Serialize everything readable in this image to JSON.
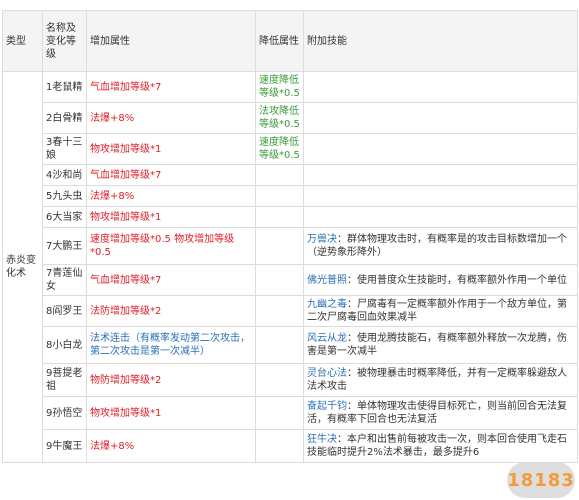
{
  "headers": {
    "type": "类型",
    "name": "名称及变化等级",
    "add": "增加属性",
    "reduce": "降低属性",
    "skill": "附加技能"
  },
  "category": "赤炎变化术",
  "rows": [
    {
      "name": "1老鼠精",
      "add": "气血增加等级*7",
      "reduce": "速度降低等级*0.5",
      "skill_name": "",
      "skill_desc": ""
    },
    {
      "name": "2白骨精",
      "add": "法爆+8%",
      "reduce": "法攻降低等级*0.5",
      "skill_name": "",
      "skill_desc": ""
    },
    {
      "name": "3春十三娘",
      "add": "物攻增加等级*1",
      "reduce": "速度降低等级*0.5",
      "skill_name": "",
      "skill_desc": ""
    },
    {
      "name": "4沙和尚",
      "add": "气血增加等级*7",
      "reduce": "",
      "skill_name": "",
      "skill_desc": ""
    },
    {
      "name": "5九头虫",
      "add": "法爆+8%",
      "reduce": "",
      "skill_name": "",
      "skill_desc": ""
    },
    {
      "name": "6大当家",
      "add": "物攻增加等级*1",
      "reduce": "",
      "skill_name": "",
      "skill_desc": ""
    },
    {
      "name": "7大鹏王",
      "add": "速度增加等级*0.5 物攻增加等级*0.5",
      "reduce": "",
      "skill_name": "万兽决",
      "skill_desc": "：群体物理攻击时，有概率是的攻击目标数增加一个（逆势象形降外）"
    },
    {
      "name": "7青莲仙女",
      "add": "气血增加等级*7",
      "reduce": "",
      "skill_name": "佛光普照",
      "skill_desc": "：使用普度众生技能时，有概率额外作用一个单位"
    },
    {
      "name": "8阎罗王",
      "add": "法防增加等级*2",
      "reduce": "",
      "skill_name": "九幽之毒",
      "skill_desc": "：尸腐毒有一定概率额外作用于一个敌方单位，第二次尸腐毒回血效果减半"
    },
    {
      "name": "8小白龙",
      "add": "法术连击（有概率发动第二次攻击，第二次攻击是第一次减半）",
      "reduce": "",
      "skill_name": "风云从龙",
      "skill_desc": "：使用龙腾技能石，有概率额外释放一次龙腾，伤害是第一次减半"
    },
    {
      "name": "9菩提老祖",
      "add": "物防增加等级*2",
      "reduce": "",
      "skill_name": "灵台心法",
      "skill_desc": "：被物理暴击时概率降低，并有一定概率躲避敌人法术攻击"
    },
    {
      "name": "9孙悟空",
      "add": "物攻增加等级*1",
      "reduce": "",
      "skill_name": "奋起千钧",
      "skill_desc": "：单体物理攻击使得目标死亡，则当前回合无法复活，有概率下回合也无法复活"
    },
    {
      "name": "9牛魔王",
      "add": "法爆+8%",
      "reduce": "",
      "skill_name": "狂牛决",
      "skill_desc": "：本户和出售前每被攻击一次，则本回合使用飞走石技能临时提升2%法术暴击，最多提升6"
    }
  ],
  "watermark": "18183",
  "colors": {
    "red": "#e0202a",
    "green": "#3a9a3a",
    "blue": "#2a6fb8"
  }
}
